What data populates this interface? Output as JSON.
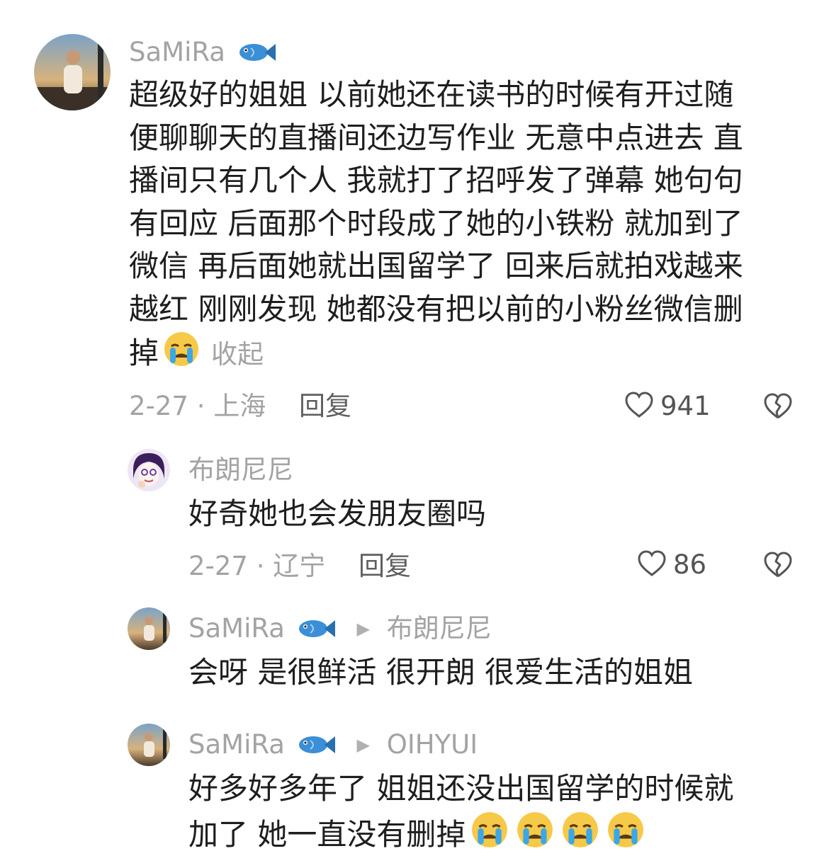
{
  "comments": [
    {
      "author": "SaMiRa",
      "text": "超级好的姐姐 以前她还在读书的时候有开过随便聊聊天的直播间还边写作业 无意中点进去 直播间只有几个人 我就打了招呼发了弹幕 她句句有回应 后面那个时段成了她的小铁粉 就加到了微信 再后面她就出国留学了 回来后就拍戏越来越红 刚刚发现 她都没有把以前的小粉丝微信删掉",
      "text_lines": [
        "超级好的姐姐 以前她还在读书的时候有开过随",
        "便聊聊天的直播间还边写作业 无意中点进去 直",
        "播间只有几个人 我就打了招呼发了弹幕 她句句",
        "有回应 后面那个时段成了她的小铁粉 就加到了",
        "微信 再后面她就出国留学了 回来后就拍戏越来",
        "越红 刚刚发现 她都没有把以前的小粉丝微信删"
      ],
      "last_line": "掉",
      "collapse_label": "收起",
      "date_location": "2-27 · 上海",
      "reply_label": "回复",
      "likes": "941"
    },
    {
      "author": "布朗尼尼",
      "text": "好奇她也会发朋友圈吗",
      "date_location": "2-27 · 辽宁",
      "reply_label": "回复",
      "likes": "86"
    },
    {
      "author": "SaMiRa",
      "reply_to": "布朗尼尼",
      "text": "会呀 是很鲜活 很开朗 很爱生活的姐姐"
    },
    {
      "author": "SaMiRa",
      "reply_to": "OIHYUI",
      "text_lines": [
        "好多好多年了 姐姐还没出国留学的时候就",
        "加了 她一直没有删掉"
      ]
    }
  ],
  "colors": {
    "name": "#a3a3a3",
    "text": "#1e1e1e",
    "emoji": "#f7c948",
    "tear": "#3aa8e8"
  },
  "icons": [
    "fish-icon",
    "crying-emoji-icon",
    "heart-icon",
    "broken-heart-icon",
    "arrow-right-icon"
  ]
}
